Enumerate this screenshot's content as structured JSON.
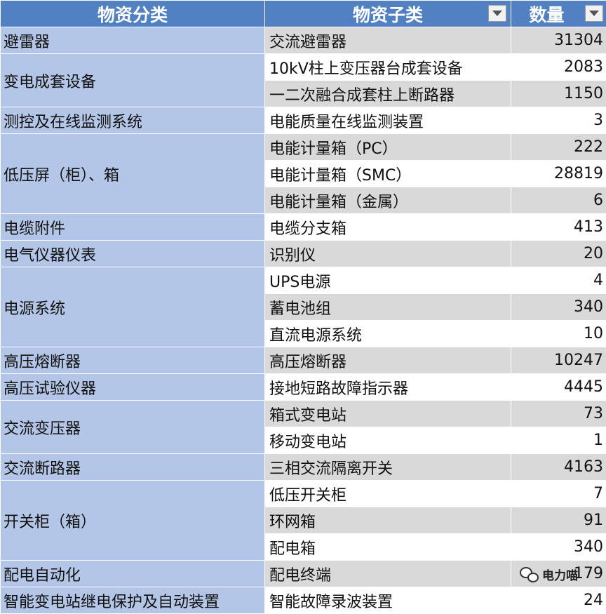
{
  "headers": {
    "category": "物资分类",
    "subcategory": "物资子类",
    "quantity": "数量"
  },
  "groups": [
    {
      "category": "避雷器",
      "items": [
        {
          "name": "交流避雷器",
          "qty": "31304"
        }
      ]
    },
    {
      "category": "变电成套设备",
      "items": [
        {
          "name": "10kV柱上变压器台成套设备",
          "qty": "2083"
        },
        {
          "name": "一二次融合成套柱上断路器",
          "qty": "1150"
        }
      ]
    },
    {
      "category": "测控及在线监测系统",
      "items": [
        {
          "name": "电能质量在线监测装置",
          "qty": "3"
        }
      ]
    },
    {
      "category": "低压屏（柜）、箱",
      "items": [
        {
          "name": "电能计量箱（PC）",
          "qty": "222"
        },
        {
          "name": "电能计量箱（SMC）",
          "qty": "28819"
        },
        {
          "name": "电能计量箱（金属）",
          "qty": "6"
        }
      ]
    },
    {
      "category": "电缆附件",
      "items": [
        {
          "name": "电缆分支箱",
          "qty": "413"
        }
      ]
    },
    {
      "category": "电气仪器仪表",
      "items": [
        {
          "name": "识别仪",
          "qty": "20"
        }
      ]
    },
    {
      "category": "电源系统",
      "items": [
        {
          "name": "UPS电源",
          "qty": "4"
        },
        {
          "name": "蓄电池组",
          "qty": "340"
        },
        {
          "name": "直流电源系统",
          "qty": "10"
        }
      ]
    },
    {
      "category": "高压熔断器",
      "items": [
        {
          "name": "高压熔断器",
          "qty": "10247"
        }
      ]
    },
    {
      "category": "高压试验仪器",
      "items": [
        {
          "name": "接地短路故障指示器",
          "qty": "4445"
        }
      ]
    },
    {
      "category": "交流变压器",
      "items": [
        {
          "name": "箱式变电站",
          "qty": "73"
        },
        {
          "name": "移动变电站",
          "qty": "1"
        }
      ]
    },
    {
      "category": "交流断路器",
      "items": [
        {
          "name": "三相交流隔离开关",
          "qty": "4163"
        }
      ]
    },
    {
      "category": "开关柜（箱）",
      "items": [
        {
          "name": "低压开关柜",
          "qty": "7"
        },
        {
          "name": "环网箱",
          "qty": "91"
        },
        {
          "name": "配电箱",
          "qty": "340"
        }
      ]
    },
    {
      "category": "配电自动化",
      "items": [
        {
          "name": "配电终端",
          "qty": "179"
        }
      ]
    },
    {
      "category": "智能变电站继电保护及自动装置",
      "items": [
        {
          "name": "智能故障录波装置",
          "qty": "24"
        }
      ]
    }
  ],
  "watermark": {
    "text": "电力喵",
    "icon": "wechat-icon"
  },
  "colors": {
    "header": "#5181c3",
    "category": "#b4c6e7",
    "stripe": "#d9d9d9"
  }
}
